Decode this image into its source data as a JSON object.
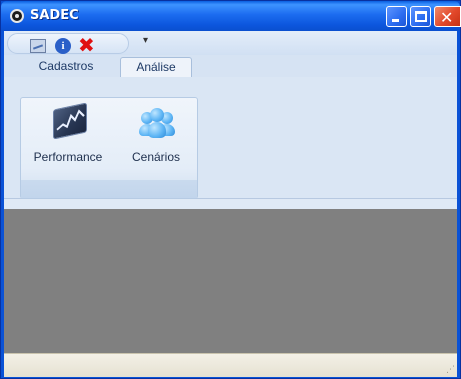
{
  "window": {
    "title": "SADEC",
    "controls": [
      "minimize",
      "maximize",
      "close"
    ]
  },
  "quick_access": {
    "icons": [
      "chart-icon",
      "info-icon",
      "exit-icon"
    ],
    "dropdown_glyph": "▾"
  },
  "tabs": [
    {
      "label": "Cadastros",
      "selected": false
    },
    {
      "label": "Análise",
      "selected": true
    }
  ],
  "ribbon": {
    "buttons": [
      {
        "label": "Performance",
        "icon": "performance-chart-icon"
      },
      {
        "label": "Cenários",
        "icon": "people-icon"
      }
    ]
  },
  "colors": {
    "titlebar": "#0c56dd",
    "workspace": "#808080",
    "close_button": "#e2482a"
  }
}
